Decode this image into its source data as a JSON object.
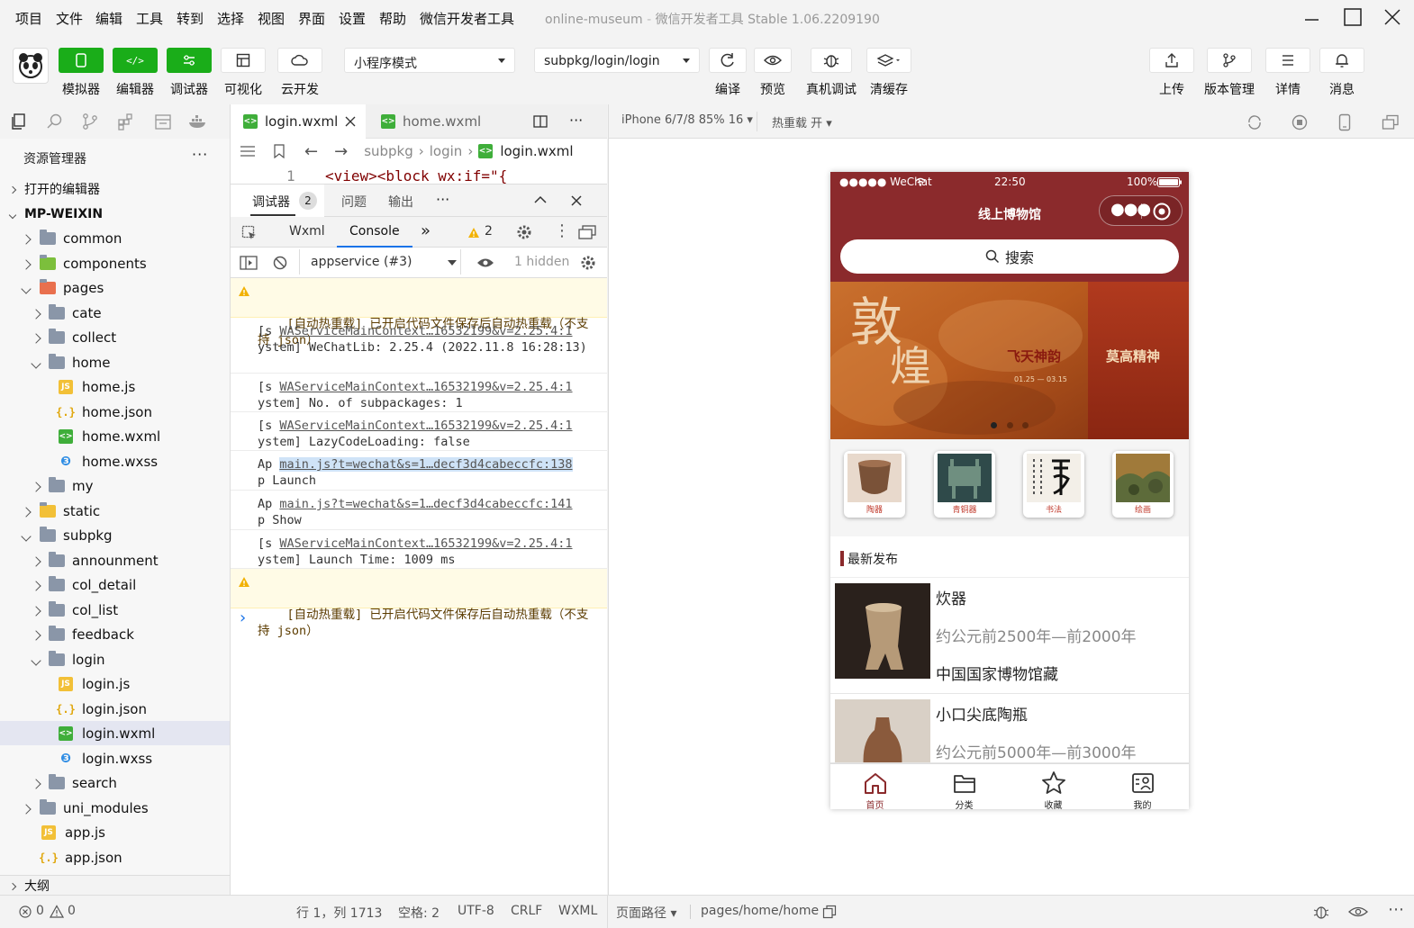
{
  "menu": [
    "项目",
    "文件",
    "编辑",
    "工具",
    "转到",
    "选择",
    "视图",
    "界面",
    "设置",
    "帮助",
    "微信开发者工具"
  ],
  "window_title": {
    "project": "online-museum",
    "separator": "-",
    "app": "微信开发者工具 Stable 1.06.2209190"
  },
  "toolbar": {
    "simulator": "模拟器",
    "editor": "编辑器",
    "debugger": "调试器",
    "visual": "可视化",
    "cloud": "云开发",
    "mode": "小程序模式",
    "page_path": "subpkg/login/login",
    "compile": "编译",
    "preview": "预览",
    "real_debug": "真机调试",
    "clear_cache": "清缓存",
    "upload": "上传",
    "version": "版本管理",
    "details": "详情",
    "messages": "消息"
  },
  "explorer": {
    "title": "资源管理器",
    "more": "···",
    "open_editors": "打开的编辑器",
    "root": "MP-WEIXIN",
    "items": [
      "common",
      "components",
      "pages",
      "cate",
      "collect",
      "home",
      "home.js",
      "home.json",
      "home.wxml",
      "home.wxss",
      "my",
      "static",
      "subpkg",
      "announment",
      "col_detail",
      "col_list",
      "feedback",
      "login",
      "login.js",
      "login.json",
      "login.wxml",
      "login.wxss",
      "search",
      "uni_modules",
      "app.js",
      "app.json"
    ],
    "outline": "大纲"
  },
  "editor": {
    "tabs": [
      "login.wxml",
      "home.wxml"
    ],
    "breadcrumb": [
      "subpkg",
      "login",
      "login.wxml"
    ],
    "line_no": "1",
    "code": "<view><block wx:if=\"{"
  },
  "devtools": {
    "tab_debugger": "调试器",
    "debugger_count": "2",
    "tab_issues": "问题",
    "tab_output": "输出",
    "more": "···",
    "panel_wxml": "Wxml",
    "panel_console": "Console",
    "panel_more": "»",
    "warn_count": "2",
    "context": "appservice (#3)",
    "hidden": "1 hidden",
    "logs": [
      {
        "type": "warn",
        "text": "[自动热重载] 已开启代码文件保存后自动热重载（不支持 json）"
      },
      {
        "type": "log",
        "prefix": "[s",
        "link": "WAServiceMainContext…16532199&v=2.25.4:1",
        "text": "ystem] WeChatLib: 2.25.4 (2022.11.8 16:28:13)"
      },
      {
        "type": "log",
        "prefix": "[s",
        "link": "WAServiceMainContext…16532199&v=2.25.4:1",
        "text": "ystem] No. of subpackages: 1"
      },
      {
        "type": "log",
        "prefix": "[s",
        "link": "WAServiceMainContext…16532199&v=2.25.4:1",
        "text": "ystem] LazyCodeLoading: false"
      },
      {
        "type": "log",
        "prefix": "Ap",
        "link": "main.js?t=wechat&s=1…decf3d4cabeccfc:138",
        "text": "p Launch"
      },
      {
        "type": "log",
        "prefix": "Ap",
        "link": "main.js?t=wechat&s=1…decf3d4cabeccfc:141",
        "text": "p Show"
      },
      {
        "type": "log",
        "prefix": "[s",
        "link": "WAServiceMainContext…16532199&v=2.25.4:1",
        "text": "ystem] Launch Time: 1009 ms"
      },
      {
        "type": "warn",
        "text": "[自动热重载] 已开启代码文件保存后自动热重载（不支持 json）"
      }
    ],
    "prompt": "›"
  },
  "simulator": {
    "device": "iPhone 6/7/8 85% 16",
    "hot_reload": "热重载 开",
    "status": {
      "carrier": "●●●●● WeChat",
      "time": "22:50",
      "battery": "100%"
    },
    "nav_title": "线上博物馆",
    "search": "搜索",
    "banner": {
      "big1": "敦",
      "big2": "煌",
      "slogan1": "飞天神韵",
      "slogan2": "莫高精神",
      "dates": "01.25 — 03.15"
    },
    "categories": [
      "陶器",
      "青铜器",
      "书法",
      "绘画"
    ],
    "section": "最新发布",
    "items": [
      {
        "name": "炊器",
        "date": "约公元前2500年—前2000年",
        "loc": "中国国家博物馆藏"
      },
      {
        "name": "小口尖底陶瓶",
        "date": "约公元前5000年—前3000年"
      }
    ],
    "tabs": [
      "首页",
      "分类",
      "收藏",
      "我的"
    ],
    "accent": "#8b2a2c"
  },
  "statusbar": {
    "errors": "0",
    "warnings": "0",
    "position": "行 1，列 1713",
    "spaces": "空格: 2",
    "encoding": "UTF-8",
    "eol": "CRLF",
    "lang": "WXML",
    "page_path_label": "页面路径",
    "page_path": "pages/home/home"
  }
}
